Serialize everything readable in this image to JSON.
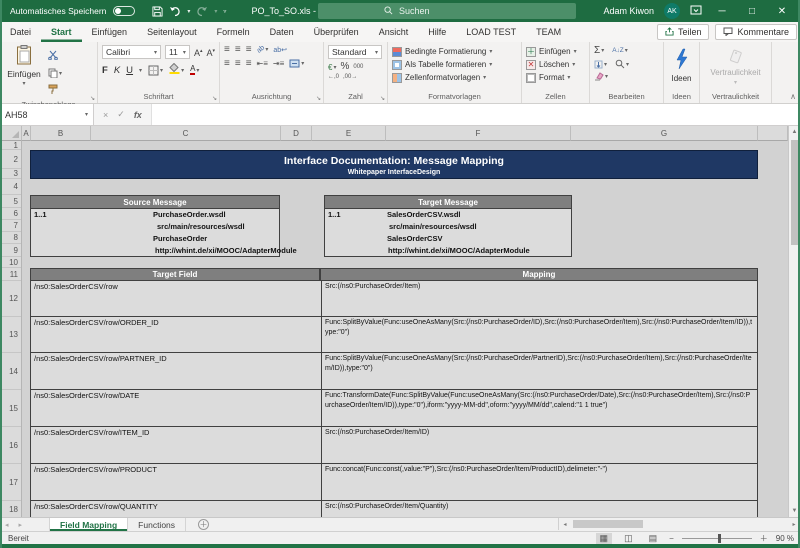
{
  "window": {
    "autosave_label": "Automatisches Speichern",
    "title": "PO_To_SO.xls - Ex...",
    "search_placeholder": "Suchen",
    "user_name": "Adam Kiwon",
    "user_initials": "AK"
  },
  "ribbon": {
    "tabs": [
      "Datei",
      "Start",
      "Einfügen",
      "Seitenlayout",
      "Formeln",
      "Daten",
      "Überprüfen",
      "Ansicht",
      "Hilfe",
      "LOAD TEST",
      "TEAM"
    ],
    "active_tab": "Start",
    "share_label": "Teilen",
    "comments_label": "Kommentare",
    "groups": {
      "clipboard": {
        "paste": "Einfügen",
        "label": "Zwischenablage"
      },
      "font": {
        "name": "Calibri",
        "size": "11",
        "bold": "F",
        "italic": "K",
        "underline": "U",
        "label": "Schriftart"
      },
      "alignment": {
        "wrap": "ab",
        "label": "Ausrichtung"
      },
      "number": {
        "format": "Standard",
        "percent": "%",
        "thousands": "000",
        "currency": "€",
        "inc_decimal": "←,0",
        "dec_decimal": ",00→",
        "label": "Zahl"
      },
      "styles": {
        "items": [
          "Bedingte Formatierung",
          "Als Tabelle formatieren",
          "Zellenformatvorlagen"
        ],
        "label": "Formatvorlagen"
      },
      "cells": {
        "items": [
          "Einfügen",
          "Löschen",
          "Format"
        ],
        "label": "Zellen"
      },
      "editing": {
        "sum": "Σ",
        "sort": "A↓Z",
        "label": "Bearbeiten"
      },
      "ideas": {
        "button": "Ideen",
        "label": "Ideen"
      },
      "sensitivity": {
        "button": "Vertraulichkeit",
        "label": "Vertraulichkeit"
      }
    }
  },
  "formula_bar": {
    "name_box": "AH58",
    "fx": "fx"
  },
  "sheet": {
    "col_headers": [
      "A",
      "B",
      "C",
      "D",
      "E",
      "F",
      "G"
    ],
    "row_numbers": [
      "1",
      "2",
      "3",
      "4",
      "5",
      "6",
      "7",
      "8",
      "9",
      "10",
      "11",
      "12",
      "13",
      "14",
      "15",
      "16",
      "17",
      "18"
    ],
    "banner": {
      "title": "Interface Documentation: Message Mapping",
      "subtitle": "Whitepaper InterfaceDesign"
    },
    "source_message": {
      "header": "Source Message",
      "cardinality": "1..1",
      "file": "PurchaseOrder.wsdl",
      "path": "src/main/resources/wsdl",
      "name": "PurchaseOrder",
      "url": "http://whint.de/xi/MOOC/AdapterModule"
    },
    "target_message": {
      "header": "Target Message",
      "cardinality": "1..1",
      "file": "SalesOrderCSV.wsdl",
      "path": "src/main/resources/wsdl",
      "name": "SalesOrderCSV",
      "url": "http://whint.de/xi/MOOC/AdapterModule"
    },
    "mapping_table": {
      "col1_header": "Target Field",
      "col2_header": "Mapping",
      "rows": [
        {
          "target": "/ns0:SalesOrderCSV/row",
          "mapping": "Src:(/ns0:PurchaseOrder/Item)"
        },
        {
          "target": "/ns0:SalesOrderCSV/row/ORDER_ID",
          "mapping": "Func:SplitByValue(Func:useOneAsMany(Src:(/ns0:PurchaseOrder/ID),Src:(/ns0:PurchaseOrder/Item),Src:(/ns0:PurchaseOrder/Item/ID)),type:\"0\")"
        },
        {
          "target": "/ns0:SalesOrderCSV/row/PARTNER_ID",
          "mapping": "Func:SplitByValue(Func:useOneAsMany(Src:(/ns0:PurchaseOrder/PartnerID),Src:(/ns0:PurchaseOrder/Item),Src:(/ns0:PurchaseOrder/Item/ID)),type:\"0\")"
        },
        {
          "target": "/ns0:SalesOrderCSV/row/DATE",
          "mapping": "Func:TransformDate(Func:SplitByValue(Func:useOneAsMany(Src:(/ns0:PurchaseOrder/Date),Src:(/ns0:PurchaseOrder/Item),Src:(/ns0:PurchaseOrder/Item/ID)),type:\"0\"),iform:\"yyyy-MM-dd\",oform:\"yyyy/MM/dd\",calend:\"1 1 true\")"
        },
        {
          "target": "/ns0:SalesOrderCSV/row/ITEM_ID",
          "mapping": "Src:(/ns0:PurchaseOrder/Item/ID)"
        },
        {
          "target": "/ns0:SalesOrderCSV/row/PRODUCT",
          "mapping": "Func:concat(Func:const(,value:\"P\"),Src:(/ns0:PurchaseOrder/Item/ProductID),delimeter:\"-\")"
        },
        {
          "target": "/ns0:SalesOrderCSV/row/QUANTITY",
          "mapping": "Src:(/ns0:PurchaseOrder/Item/Quantity)"
        }
      ]
    }
  },
  "tabs_bar": {
    "sheets": [
      {
        "label": "Field Mapping",
        "active": true
      },
      {
        "label": "Functions",
        "active": false
      }
    ]
  },
  "status_bar": {
    "status": "Bereit",
    "zoom": "90 %"
  },
  "colors": {
    "accent_green": "#217346",
    "titlebar_green": "#1e6c41",
    "banner_navy": "#1f3864",
    "header_gray": "#7f7f7f",
    "ideas_blue": "#2e78d2"
  }
}
